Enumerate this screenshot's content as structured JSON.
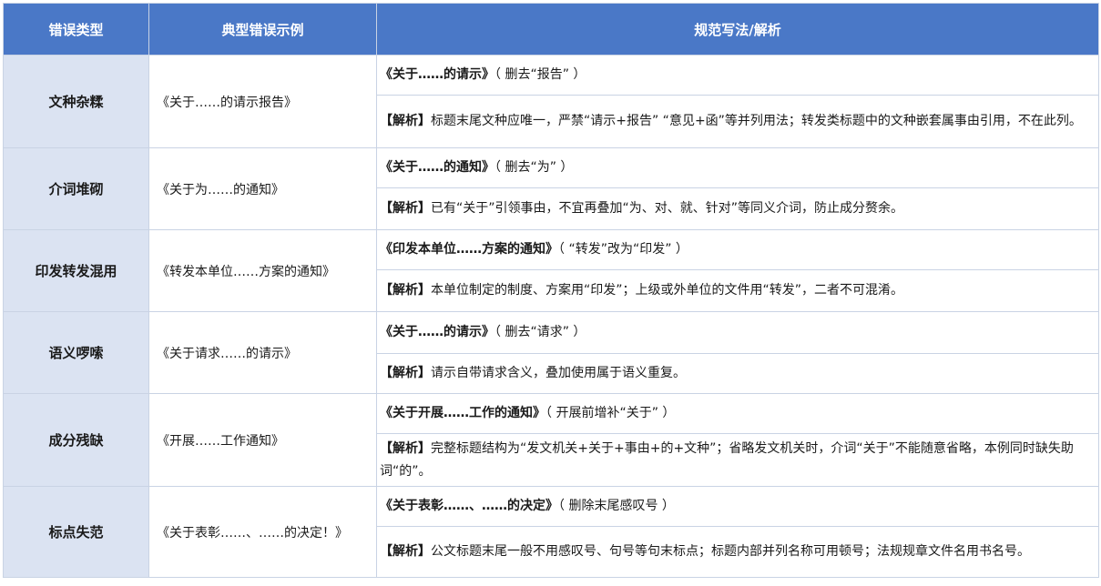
{
  "headers": {
    "type": "错误类型",
    "example": "典型错误示例",
    "fix": "规范写法/解析"
  },
  "analysis_prefix": "【解析】",
  "rows": [
    {
      "type": "文种杂糅",
      "example": "《关于……的请示报告》",
      "fix_title": "《关于……的请示》",
      "fix_note": "（ 删去“报告” ）",
      "analysis": "标题末尾文种应唯一，严禁“请示+报告” “意见+函”等并列用法；转发类标题中的文种嵌套属事由引用，不在此列。"
    },
    {
      "type": "介词堆砌",
      "example": "《关于为……的通知》",
      "fix_title": "《关于……的通知》",
      "fix_note": "（ 删去“为” ）",
      "analysis": "已有“关于”引领事由，不宜再叠加“为、对、就、针对”等同义介词，防止成分赘余。"
    },
    {
      "type": "印发转发混用",
      "example": "《转发本单位……方案的通知》",
      "fix_title": "《印发本单位……方案的通知》",
      "fix_note": "（ “转发”改为“印发” ）",
      "analysis": "本单位制定的制度、方案用“印发”；上级或外单位的文件用“转发”，二者不可混淆。"
    },
    {
      "type": "语义啰嗦",
      "example": "《关于请求……的请示》",
      "fix_title": "《关于……的请示》",
      "fix_note": "（ 删去“请求” ）",
      "analysis": "请示自带请求含义，叠加使用属于语义重复。"
    },
    {
      "type": "成分残缺",
      "example": "《开展……工作通知》",
      "fix_title": "《关于开展……工作的通知》",
      "fix_note": "（ 开展前增补“关于” ）",
      "analysis": "完整标题结构为“发文机关+关于+事由+的+文种”；省略发文机关时，介词“关于”不能随意省略，本例同时缺失助词“的”。"
    },
    {
      "type": "标点失范",
      "example": "《关于表彰……、……的决定！》",
      "fix_title": "《关于表彰……、……的决定》",
      "fix_note": "（ 删除末尾感叹号 ）",
      "analysis": "公文标题末尾一般不用感叹号、句号等句末标点；标题内部并列名称可用顿号；法规规章文件名用书名号。"
    }
  ]
}
